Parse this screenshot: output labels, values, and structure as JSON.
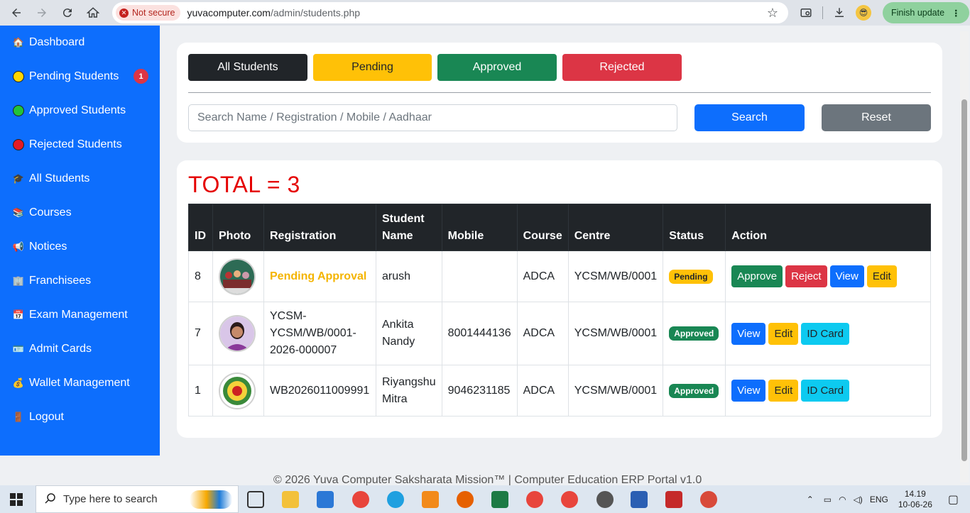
{
  "browser": {
    "security_label": "Not secure",
    "url_domain": "yuvacomputer.com",
    "url_path": "/admin/students.php",
    "update_label": "Finish update"
  },
  "sidebar": {
    "items": [
      {
        "label": "Dashboard",
        "icon": "house-icon"
      },
      {
        "label": "Pending Students",
        "icon": "yellow-circle-icon",
        "badge": "1"
      },
      {
        "label": "Approved Students",
        "icon": "green-circle-icon"
      },
      {
        "label": "Rejected Students",
        "icon": "red-circle-icon"
      },
      {
        "label": "All Students",
        "icon": "graduation-cap-icon"
      },
      {
        "label": "Courses",
        "icon": "books-icon"
      },
      {
        "label": "Notices",
        "icon": "megaphone-icon"
      },
      {
        "label": "Franchisees",
        "icon": "building-icon"
      },
      {
        "label": "Exam Management",
        "icon": "calendar-icon"
      },
      {
        "label": "Admit Cards",
        "icon": "id-card-icon"
      },
      {
        "label": "Wallet Management",
        "icon": "money-bag-icon"
      },
      {
        "label": "Logout",
        "icon": "door-icon"
      }
    ]
  },
  "filters": {
    "all": "All Students",
    "pending": "Pending",
    "approved": "Approved",
    "rejected": "Rejected"
  },
  "search": {
    "placeholder": "Search Name / Registration / Mobile / Aadhaar",
    "search_label": "Search",
    "reset_label": "Reset"
  },
  "summary": {
    "total_text": "TOTAL = 3"
  },
  "table": {
    "headers": [
      "ID",
      "Photo",
      "Registration",
      "Student Name",
      "Mobile",
      "Course",
      "Centre",
      "Status",
      "Action"
    ],
    "rows": [
      {
        "id": "8",
        "registration": "Pending Approval",
        "name": "arush",
        "mobile": "",
        "course": "ADCA",
        "centre": "YCSM/WB/0001",
        "status": "Pending",
        "actions": [
          "Approve",
          "Reject",
          "View",
          "Edit"
        ]
      },
      {
        "id": "7",
        "registration": "YCSM-YCSM/WB/0001-2026-000007",
        "name": "Ankita Nandy",
        "mobile": "8001444136",
        "course": "ADCA",
        "centre": "YCSM/WB/0001",
        "status": "Approved",
        "actions": [
          "View",
          "Edit",
          "ID Card"
        ]
      },
      {
        "id": "1",
        "registration": "WB2026011009991",
        "name": "Riyangshu Mitra",
        "mobile": "9046231185",
        "course": "ADCA",
        "centre": "YCSM/WB/0001",
        "status": "Approved",
        "actions": [
          "View",
          "Edit",
          "ID Card"
        ]
      }
    ]
  },
  "footer": {
    "text": "© 2026 Yuva Computer Saksharata Mission™ | Computer Education ERP Portal v1.0"
  },
  "taskbar": {
    "search_placeholder": "Type here to search",
    "language": "ENG",
    "time": "14.19",
    "date": "10-06-26"
  },
  "colors": {
    "sidebar": "#0d6efd",
    "dark": "#212529",
    "warning": "#ffc107",
    "success": "#198754",
    "danger": "#dc3545",
    "primary": "#0d6efd",
    "secondary": "#6c757d",
    "info": "#0dcaf0"
  }
}
